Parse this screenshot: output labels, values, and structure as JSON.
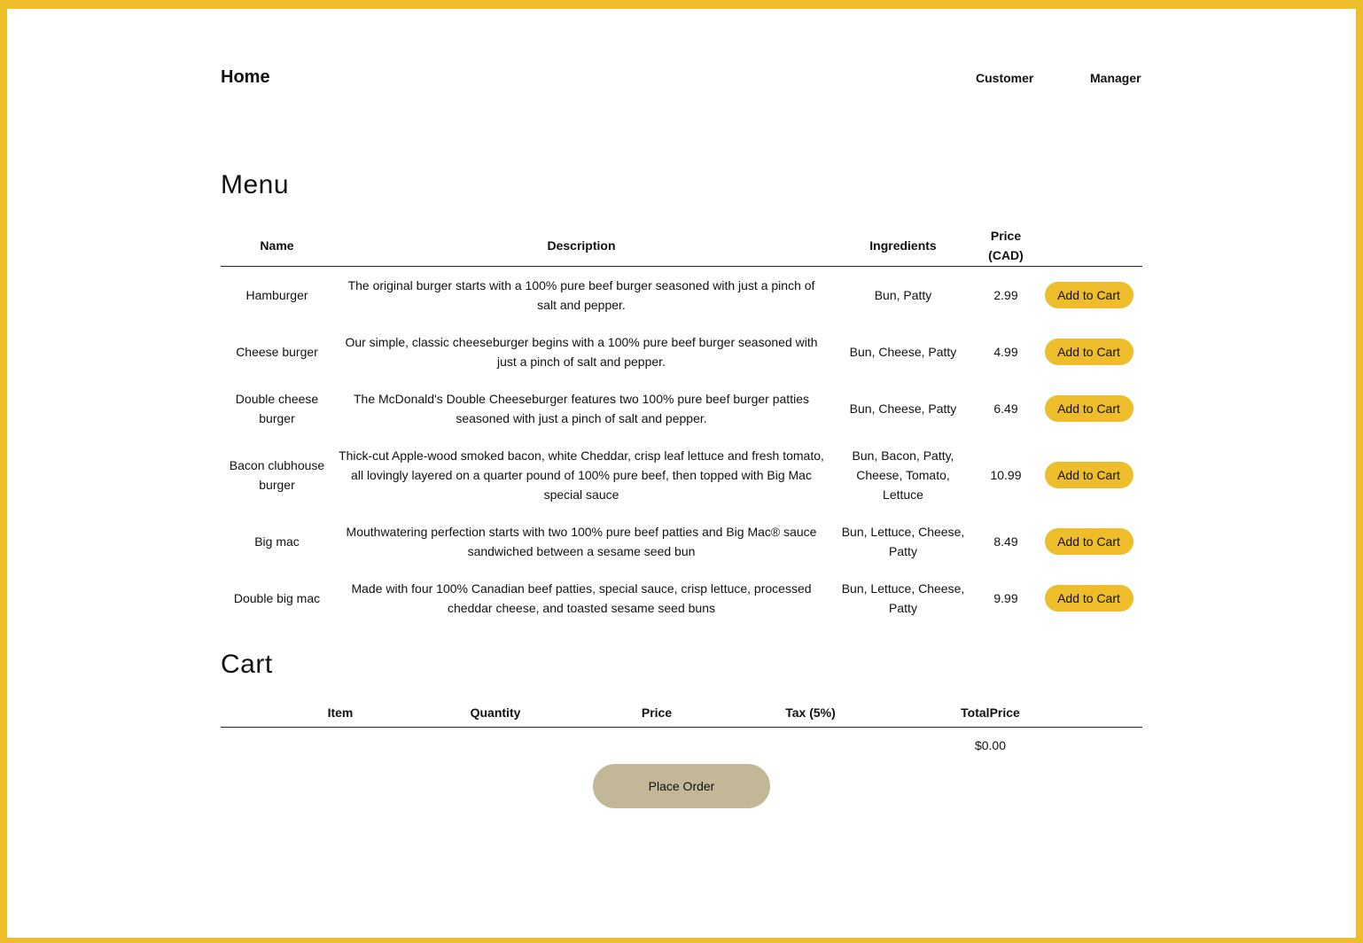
{
  "colors": {
    "accent": "#eebd2b",
    "place_order_bg": "#c2b796",
    "text": "#111111"
  },
  "nav": {
    "home": "Home",
    "customer": "Customer",
    "manager": "Manager"
  },
  "menu": {
    "title": "Menu",
    "headers": {
      "name": "Name",
      "description": "Description",
      "ingredients": "Ingredients",
      "price": "Price (CAD)"
    },
    "add_label": "Add to Cart",
    "items": [
      {
        "name": "Hamburger",
        "description": "The original burger starts with a 100% pure beef burger seasoned with just a pinch of salt and pepper.",
        "ingredients": "Bun, Patty",
        "price": "2.99"
      },
      {
        "name": "Cheese burger",
        "description": "Our simple, classic cheeseburger begins with a 100% pure beef burger seasoned with just a pinch of salt and pepper.",
        "ingredients": "Bun, Cheese, Patty",
        "price": "4.99"
      },
      {
        "name": "Double cheese burger",
        "description": "The McDonald's Double Cheeseburger features two 100% pure beef burger patties seasoned with just a pinch of salt and pepper.",
        "ingredients": "Bun, Cheese, Patty",
        "price": "6.49"
      },
      {
        "name": "Bacon clubhouse burger",
        "description": "Thick-cut Apple-wood smoked bacon, white Cheddar, crisp leaf lettuce and fresh tomato, all lovingly layered on a quarter pound of 100% pure beef, then topped with Big Mac special sauce",
        "ingredients": "Bun, Bacon, Patty, Cheese, Tomato, Lettuce",
        "price": "10.99"
      },
      {
        "name": "Big mac",
        "description": "Mouthwatering perfection starts with two 100% pure beef patties and Big Mac® sauce sandwiched between a sesame seed bun",
        "ingredients": "Bun, Lettuce, Cheese, Patty",
        "price": "8.49"
      },
      {
        "name": "Double big mac",
        "description": "Made with four 100% Canadian beef patties, special sauce, crisp lettuce, processed cheddar cheese, and toasted sesame seed buns",
        "ingredients": "Bun, Lettuce, Cheese, Patty",
        "price": "9.99"
      }
    ]
  },
  "cart": {
    "title": "Cart",
    "headers": {
      "item": "Item",
      "quantity": "Quantity",
      "price": "Price",
      "tax": "Tax (5%)",
      "total": "TotalPrice"
    },
    "total_value": "$0.00",
    "place_order": "Place Order"
  }
}
